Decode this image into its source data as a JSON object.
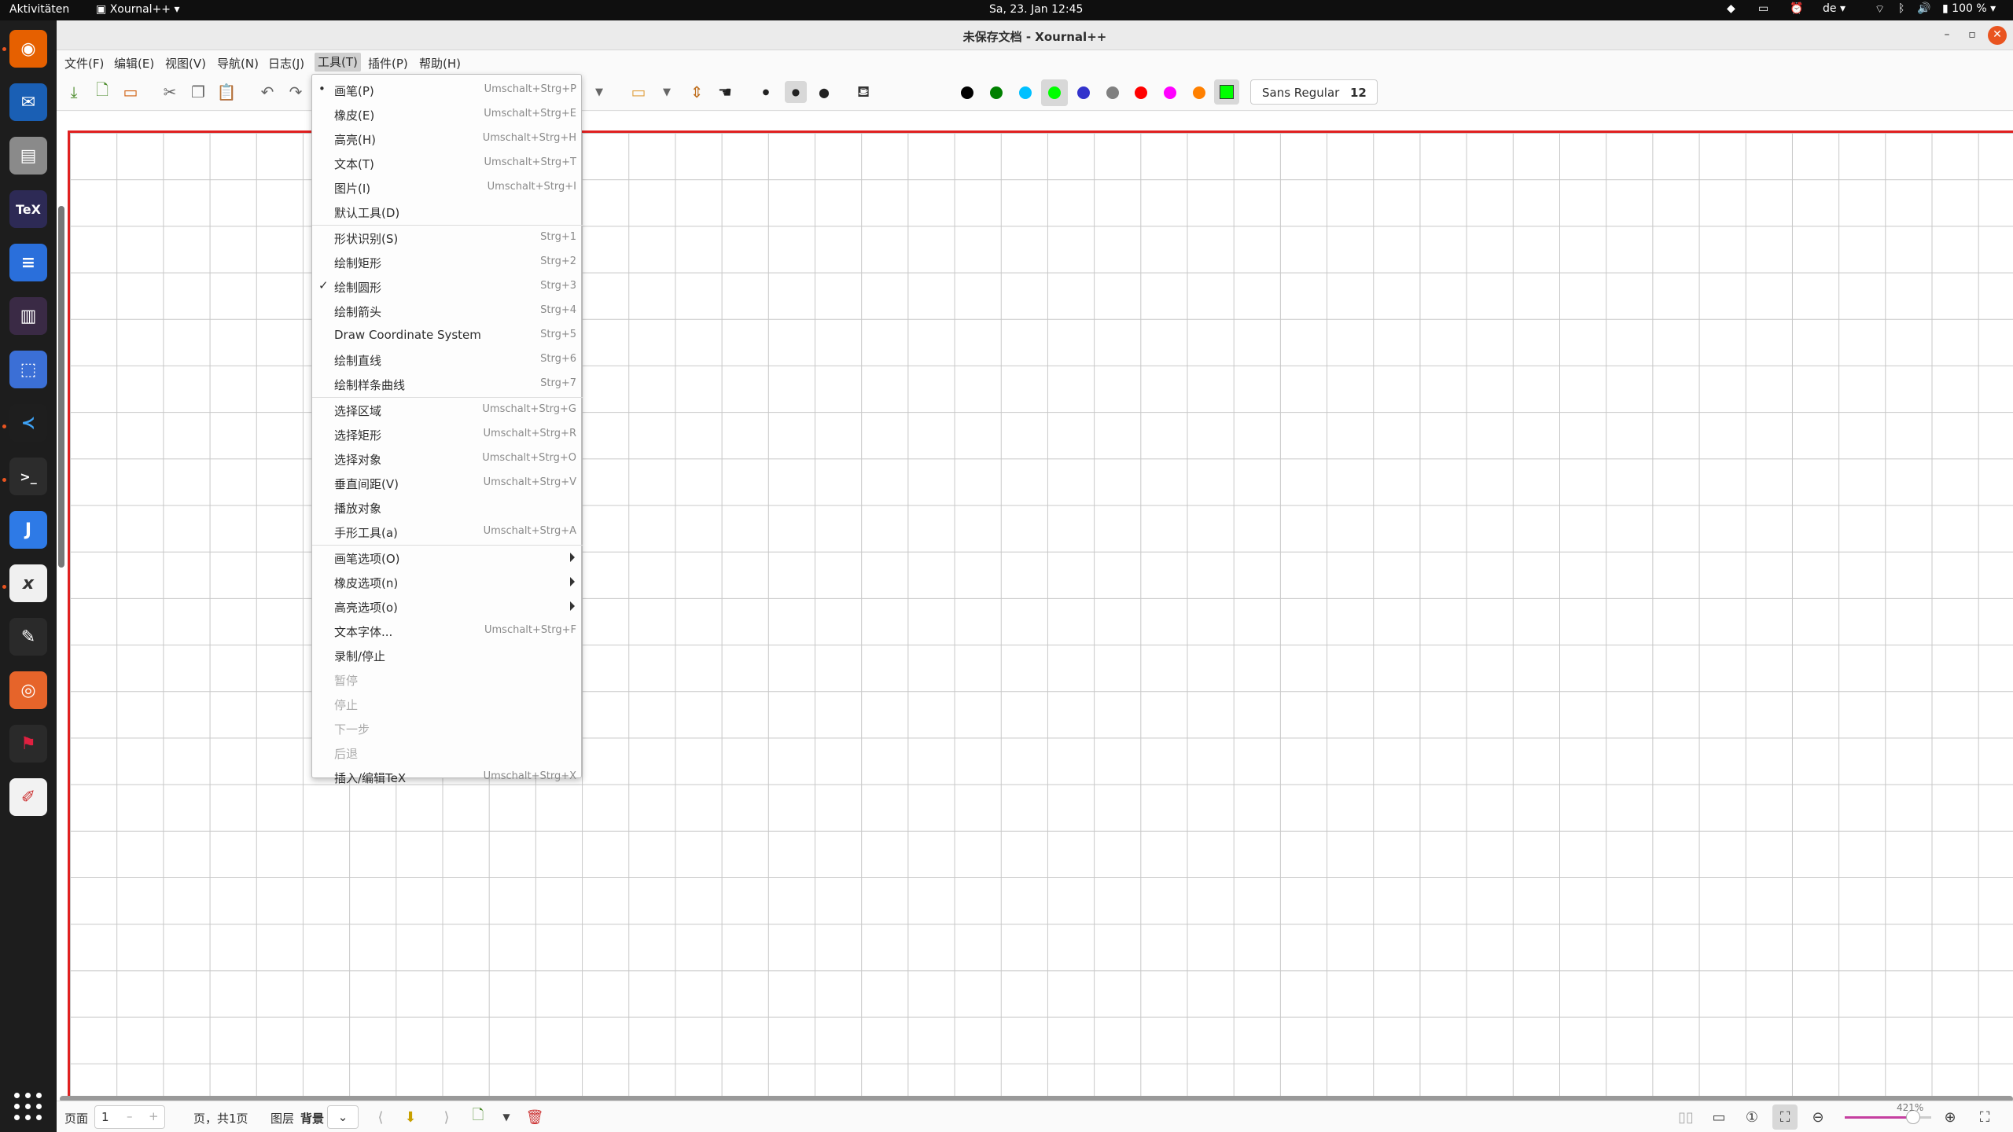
{
  "topbar": {
    "activities": "Aktivitäten",
    "app_name": "Xournal++",
    "clock": "Sa, 23. Jan  12:45",
    "keyboard_layout": "de",
    "battery": "100 %"
  },
  "window": {
    "title": "未保存文档 - Xournal++"
  },
  "menubar": [
    "文件(F)",
    "编辑(E)",
    "视图(V)",
    "导航(N)",
    "日志(J)",
    "工具(T)",
    "插件(P)",
    "帮助(H)"
  ],
  "toolbar": {
    "font_name": "Sans Regular",
    "font_size": "12",
    "colors": [
      "#000000",
      "#008000",
      "#00c0ff",
      "#00ff00",
      "#3333cc",
      "#808080",
      "#ff0000",
      "#ff00ff",
      "#ff8000",
      "#ffff00",
      "#ffffff"
    ],
    "selected_color": "#00ff00",
    "active_color_box": "#00ff00"
  },
  "tools_menu": {
    "items": [
      {
        "label": "画笔(P)",
        "shortcut": "Umschalt+Strg+P",
        "mark": "•"
      },
      {
        "label": "橡皮(E)",
        "shortcut": "Umschalt+Strg+E"
      },
      {
        "label": "高亮(H)",
        "shortcut": "Umschalt+Strg+H"
      },
      {
        "label": "文本(T)",
        "shortcut": "Umschalt+Strg+T"
      },
      {
        "label": "图片(I)",
        "shortcut": "Umschalt+Strg+I"
      },
      {
        "label": "默认工具(D)",
        "shortcut": ""
      },
      {
        "label": "形状识别(S)",
        "shortcut": "Strg+1"
      },
      {
        "label": "绘制矩形",
        "shortcut": "Strg+2"
      },
      {
        "label": "绘制圆形",
        "shortcut": "Strg+3",
        "mark": "✓"
      },
      {
        "label": "绘制箭头",
        "shortcut": "Strg+4"
      },
      {
        "label": "Draw Coordinate System",
        "shortcut": "Strg+5"
      },
      {
        "label": "绘制直线",
        "shortcut": "Strg+6"
      },
      {
        "label": "绘制样条曲线",
        "shortcut": "Strg+7"
      },
      {
        "label": "选择区域",
        "shortcut": "Umschalt+Strg+G"
      },
      {
        "label": "选择矩形",
        "shortcut": "Umschalt+Strg+R"
      },
      {
        "label": "选择对象",
        "shortcut": "Umschalt+Strg+O"
      },
      {
        "label": "垂直间距(V)",
        "shortcut": "Umschalt+Strg+V"
      },
      {
        "label": "播放对象",
        "shortcut": ""
      },
      {
        "label": "手形工具(a)",
        "shortcut": "Umschalt+Strg+A"
      },
      {
        "label": "画笔选项(O)",
        "shortcut": ""
      },
      {
        "label": "橡皮选项(n)",
        "shortcut": ""
      },
      {
        "label": "高亮选项(o)",
        "shortcut": ""
      },
      {
        "label": "文本字体...",
        "shortcut": "Umschalt+Strg+F"
      },
      {
        "label": "录制/停止",
        "shortcut": ""
      },
      {
        "label": "暂停",
        "shortcut": ""
      },
      {
        "label": "停止",
        "shortcut": ""
      },
      {
        "label": "下一步",
        "shortcut": ""
      },
      {
        "label": "后退",
        "shortcut": ""
      },
      {
        "label": "插入/编辑TeX",
        "shortcut": "Umschalt+Strg+X"
      }
    ]
  },
  "statusbar": {
    "page_label": "页面",
    "page_value": "1",
    "page_count": "页，共1页",
    "layer_label": "图层",
    "layer_value": "背景",
    "zoom_percent": "421%"
  }
}
